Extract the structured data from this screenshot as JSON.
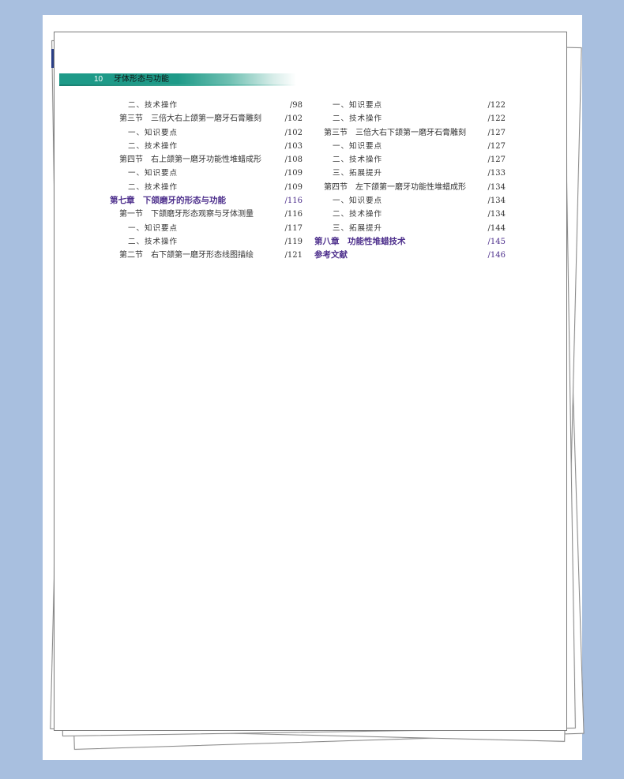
{
  "header": {
    "page_number": "10",
    "running_title": "牙体形态与功能"
  },
  "colors": {
    "background": "#a8bfdf",
    "header_bar": "#1e9a88",
    "chapter_text": "#4d2f8c",
    "body_text": "#333333"
  },
  "toc": {
    "left_column": [
      {
        "level": "sub",
        "label": "二、技术操作",
        "page": "/98"
      },
      {
        "level": "sec",
        "label": "第三节　三倍大右上颌第一磨牙石膏雕刻",
        "page": "/102"
      },
      {
        "level": "sub",
        "label": "一、知识要点",
        "page": "/102"
      },
      {
        "level": "sub",
        "label": "二、技术操作",
        "page": "/103"
      },
      {
        "level": "sec",
        "label": "第四节　右上颌第一磨牙功能性堆蜡成形",
        "page": "/108"
      },
      {
        "level": "sub",
        "label": "一、知识要点",
        "page": "/109"
      },
      {
        "level": "sub",
        "label": "二、技术操作",
        "page": "/109"
      },
      {
        "level": "chap",
        "label": "第七章　下颌磨牙的形态与功能",
        "page": "/116"
      },
      {
        "level": "sec",
        "label": "第一节　下颌磨牙形态观察与牙体测量",
        "page": "/116"
      },
      {
        "level": "sub",
        "label": "一、知识要点",
        "page": "/117"
      },
      {
        "level": "sub",
        "label": "二、技术操作",
        "page": "/119"
      },
      {
        "level": "sec",
        "label": "第二节　右下颌第一磨牙形态线图描绘",
        "page": "/121"
      }
    ],
    "right_column": [
      {
        "level": "sub",
        "label": "一、知识要点",
        "page": "/122"
      },
      {
        "level": "sub",
        "label": "二、技术操作",
        "page": "/122"
      },
      {
        "level": "sec",
        "label": "第三节　三倍大右下颌第一磨牙石膏雕刻",
        "page": "/127"
      },
      {
        "level": "sub",
        "label": "一、知识要点",
        "page": "/127"
      },
      {
        "level": "sub",
        "label": "二、技术操作",
        "page": "/127"
      },
      {
        "level": "sub",
        "label": "三、拓展提升",
        "page": "/133"
      },
      {
        "level": "sec",
        "label": "第四节　左下颌第一磨牙功能性堆蜡成形",
        "page": "/134"
      },
      {
        "level": "sub",
        "label": "一、知识要点",
        "page": "/134"
      },
      {
        "level": "sub",
        "label": "二、技术操作",
        "page": "/134"
      },
      {
        "level": "sub",
        "label": "三、拓展提升",
        "page": "/144"
      },
      {
        "level": "chap",
        "label": "第八章　功能性堆蜡技术",
        "page": "/145"
      },
      {
        "level": "chap",
        "label": "参考文献",
        "page": "/146"
      }
    ]
  }
}
